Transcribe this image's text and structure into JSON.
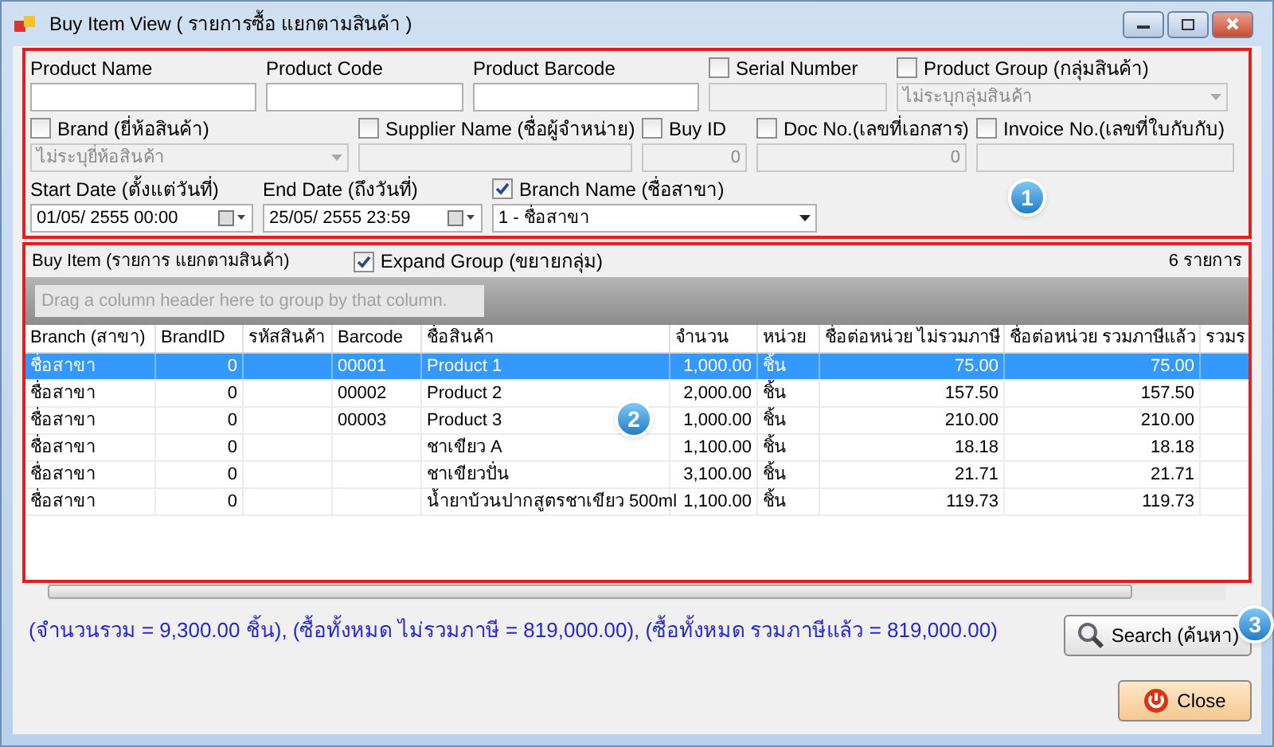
{
  "window": {
    "title": "Buy Item View ( รายการซื้อ แยกตามสินค้า )"
  },
  "filters": {
    "rows": [
      [
        {
          "kind": "text",
          "label": "Product Name"
        },
        {
          "kind": "text",
          "label": "Product Code"
        },
        {
          "kind": "text",
          "label": "Product Barcode"
        },
        {
          "kind": "checktext",
          "label": "Serial Number",
          "checked": false
        },
        {
          "kind": "checkcombo",
          "label": "Product Group (กลุ่มสินค้า)",
          "checked": false,
          "value": "ไม่ระบุกลุ่มสินค้า"
        }
      ],
      [
        {
          "kind": "checkcombo",
          "label": "Brand (ยี่ห้อสินค้า)",
          "checked": false,
          "value": "ไม่ระบุยี่ห้อสินค้า"
        },
        {
          "kind": "checktext",
          "label": "Supplier Name (ชื่อผู้จำหน่าย)",
          "checked": false
        },
        {
          "kind": "checktext",
          "label": "Buy ID",
          "checked": false,
          "value": "0"
        },
        {
          "kind": "checktext",
          "label": "Doc No.(เลขที่เอกสาร)",
          "checked": false,
          "value": "0"
        },
        {
          "kind": "checktext",
          "label": "Invoice No.(เลขที่ใบกับกับ)",
          "checked": false
        }
      ],
      [
        {
          "kind": "date",
          "label": "Start Date (ตั้งแต่วันที่)",
          "value": "01/05/  2555 00:00"
        },
        {
          "kind": "date",
          "label": "End Date (ถึงวันที่)",
          "value": "25/05/  2555 23:59"
        },
        {
          "kind": "checkcombo",
          "label": "Branch Name (ชื่อสาขา)",
          "checked": true,
          "value": "1 - ชื่อสาขา"
        }
      ]
    ],
    "badge": "1"
  },
  "grid": {
    "title": "Buy Item (รายการ แยกตามสินค้า)",
    "expand_group": {
      "label": "Expand Group (ขยายกลุ่ม)",
      "checked": true
    },
    "count": "6 รายการ",
    "group_placeholder": "Drag a column header here to group by that column.",
    "badge": "2",
    "columns": [
      "Branch (สาขา)",
      "BrandID",
      "รหัสสินค้า",
      "Barcode",
      "ชื่อสินค้า",
      "จำนวน",
      "หน่วย",
      "ชื่อต่อหน่วย ไม่รวมภาษี",
      "ชื่อต่อหน่วย รวมภาษีแล้ว",
      "รวมร"
    ],
    "rows": [
      {
        "selected": true,
        "cells": [
          "ชื่อสาขา",
          "0",
          "",
          "00001",
          "Product 1",
          "1,000.00",
          "ชิ้น",
          "75.00",
          "75.00",
          ""
        ]
      },
      {
        "selected": false,
        "cells": [
          "ชื่อสาขา",
          "0",
          "",
          "00002",
          "Product 2",
          "2,000.00",
          "ชิ้น",
          "157.50",
          "157.50",
          ""
        ]
      },
      {
        "selected": false,
        "cells": [
          "ชื่อสาขา",
          "0",
          "",
          "00003",
          "Product 3",
          "1,000.00",
          "ชิ้น",
          "210.00",
          "210.00",
          ""
        ]
      },
      {
        "selected": false,
        "cells": [
          "ชื่อสาขา",
          "0",
          "",
          "",
          "ชาเขียว A",
          "1,100.00",
          "ชิ้น",
          "18.18",
          "18.18",
          ""
        ]
      },
      {
        "selected": false,
        "cells": [
          "ชื่อสาขา",
          "0",
          "",
          "",
          "ชาเขียวปั่น",
          "3,100.00",
          "ชิ้น",
          "21.71",
          "21.71",
          ""
        ]
      },
      {
        "selected": false,
        "cells": [
          "ชื่อสาขา",
          "0",
          "",
          "",
          "น้ำยาบ้วนปากสูตรชาเขียว  500ml",
          "1,100.00",
          "ชิ้น",
          "119.73",
          "119.73",
          ""
        ]
      }
    ]
  },
  "summary": "(จำนวนรวม = 9,300.00 ชิ้น), (ซื้อทั้งหมด ไม่รวมภาษี = 819,000.00), (ซื้อทั้งหมด รวมภาษีแล้ว = 819,000.00)",
  "buttons": {
    "search": "Search (ค้นหา)",
    "search_badge": "3",
    "close": "Close"
  }
}
